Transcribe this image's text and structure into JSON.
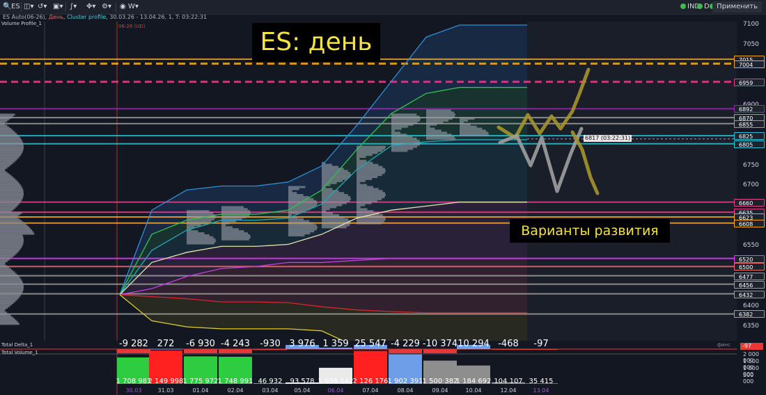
{
  "toolbar": {
    "symbol": "ES",
    "interval": "W",
    "indicators": [
      {
        "label": "IND"
      },
      {
        "label": "D"
      },
      {
        "label": "L"
      }
    ],
    "apply_label": "Применить"
  },
  "header": {
    "symbol_name": "ES Auto(06-26)",
    "timeframe": "День",
    "chart_type": "Cluster profile",
    "date_range": "30.03.26 - 13.04.26",
    "extra": "1, T: 03:22:31",
    "volume_profile_label": "Volume Profile_1",
    "contract_label": "06-26 (UD)"
  },
  "annotations": {
    "title": "ES: день",
    "variants": "Варианты развития",
    "current_price_tag": "6817 (03:22:31)"
  },
  "price_axis": {
    "ticks": [
      "7100",
      "7050",
      "7000",
      "6950",
      "6900",
      "6850",
      "6800",
      "6750",
      "6700",
      "6650",
      "6600",
      "6550",
      "6500",
      "6450",
      "6400",
      "6350"
    ],
    "ymin": 6325,
    "ymax": 7115
  },
  "level_labels": [
    {
      "value": "7015",
      "color": "#f7a823"
    },
    {
      "value": "7004",
      "color": "#f7a823"
    },
    {
      "value": "6959",
      "color": "#e83e8c"
    },
    {
      "value": "6892",
      "color": "#9c27b0"
    },
    {
      "value": "6870",
      "color": "#9e9e9e"
    },
    {
      "value": "6855",
      "color": "#9e9e9e"
    },
    {
      "value": "6825",
      "color": "#26c6da"
    },
    {
      "value": "6805",
      "color": "#26c6da"
    },
    {
      "value": "6660",
      "color": "#e83e8c"
    },
    {
      "value": "6635",
      "color": "#e83e8c"
    },
    {
      "value": "6623",
      "color": "#f7a823"
    },
    {
      "value": "6608",
      "color": "#f7a823"
    },
    {
      "value": "6520",
      "color": "#e040fb"
    },
    {
      "value": "6500",
      "color": "#ef6c6c"
    },
    {
      "value": "6477",
      "color": "#9e9e9e"
    },
    {
      "value": "6456",
      "color": "#9e9e9e"
    },
    {
      "value": "6432",
      "color": "#9e9e9e"
    },
    {
      "value": "6382",
      "color": "#9e9e9e"
    }
  ],
  "delta_panel": {
    "label": "Total Delta_1",
    "right_label": "финс",
    "right_value": "-97",
    "values": [
      "-9 282",
      "272",
      "-6 930",
      "-4 243",
      "-930",
      "3 976",
      "1 359",
      "25 547",
      "-4 229",
      "-10 374",
      "10 294",
      "-468",
      "-97"
    ]
  },
  "volume_panel": {
    "label": "Total Volume_1",
    "axis_ticks": [
      "2 000 000",
      "1 500 000",
      "1 000 000",
      "500 000"
    ],
    "values": [
      "1 708 981",
      "2 149 998",
      "1 775 972",
      "1 748 991",
      "46 932",
      "93 578",
      "1 038 142",
      "2 126 176",
      "1 902 391",
      "1 500 382",
      "1 184 692",
      "104 107",
      "35 415"
    ]
  },
  "date_axis": {
    "labels": [
      "30.03",
      "31.03",
      "01.04",
      "02.04",
      "03.04",
      "05.04",
      "06.04",
      "07.04",
      "08.04",
      "09.04",
      "10.04",
      "12.04",
      "13.04"
    ],
    "highlight_labels": [
      "30.03",
      "06.04",
      "13.04"
    ]
  },
  "chart_data": {
    "type": "line",
    "x": [
      "30.03",
      "31.03",
      "01.04",
      "02.04",
      "03.04",
      "05.04",
      "06.04",
      "07.04",
      "08.04",
      "09.04",
      "10.04",
      "12.04",
      "13.04"
    ],
    "series": [
      {
        "values": [
          6430,
          6640,
          6690,
          6700,
          6700,
          6710,
          6750,
          6850,
          6960,
          7070,
          7100,
          7100,
          7100
        ]
      },
      {
        "values": [
          6430,
          6580,
          6615,
          6630,
          6630,
          6640,
          6690,
          6790,
          6880,
          6930,
          6945,
          6945,
          6945
        ]
      },
      {
        "values": [
          6430,
          6540,
          6590,
          6615,
          6615,
          6620,
          6655,
          6740,
          6800,
          6810,
          6815,
          6815,
          6815
        ]
      },
      {
        "values": [
          6430,
          6510,
          6535,
          6550,
          6550,
          6555,
          6580,
          6620,
          6640,
          6650,
          6660,
          6660,
          6660
        ]
      },
      {
        "values": [
          6430,
          6445,
          6475,
          6495,
          6500,
          6510,
          6510,
          6515,
          6520,
          6520,
          6520,
          6520,
          6520
        ]
      },
      {
        "values": [
          6430,
          6425,
          6420,
          6412,
          6412,
          6410,
          6400,
          6392,
          6388,
          6385,
          6385,
          6385,
          6385
        ]
      },
      {
        "values": [
          6430,
          6365,
          6350,
          6345,
          6345,
          6345,
          6340,
          6300,
          6300,
          6300,
          6300,
          6300,
          6300
        ]
      }
    ]
  }
}
